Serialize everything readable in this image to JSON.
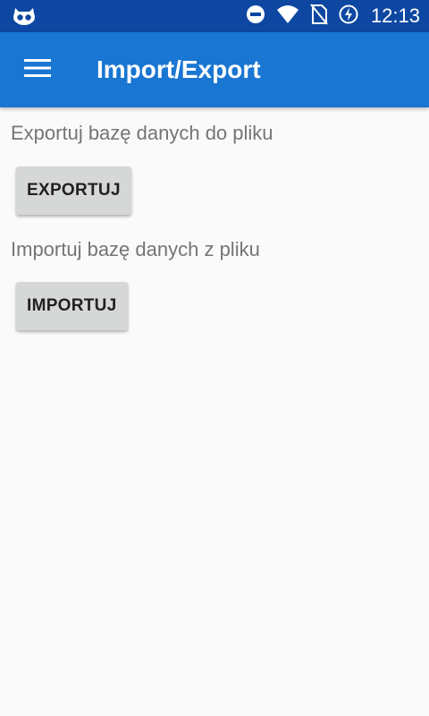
{
  "status_bar": {
    "time": "12:13",
    "icons": [
      "app-notification-icon",
      "do-not-disturb-icon",
      "wifi-icon",
      "no-sim-icon",
      "battery-charging-icon"
    ]
  },
  "app_bar": {
    "title": "Import/Export",
    "menu_icon": "hamburger-menu-icon"
  },
  "export_section": {
    "label": "Exportuj bazę danych do pliku",
    "button_label": "EXPORTUJ"
  },
  "import_section": {
    "label": "Importuj bazę danych z pliku",
    "button_label": "IMPORTUJ"
  },
  "colors": {
    "status_bar": "#0d47a1",
    "app_bar": "#1976d2",
    "background": "#fafafa",
    "button": "#d6d7d7",
    "label_text": "#757575"
  }
}
